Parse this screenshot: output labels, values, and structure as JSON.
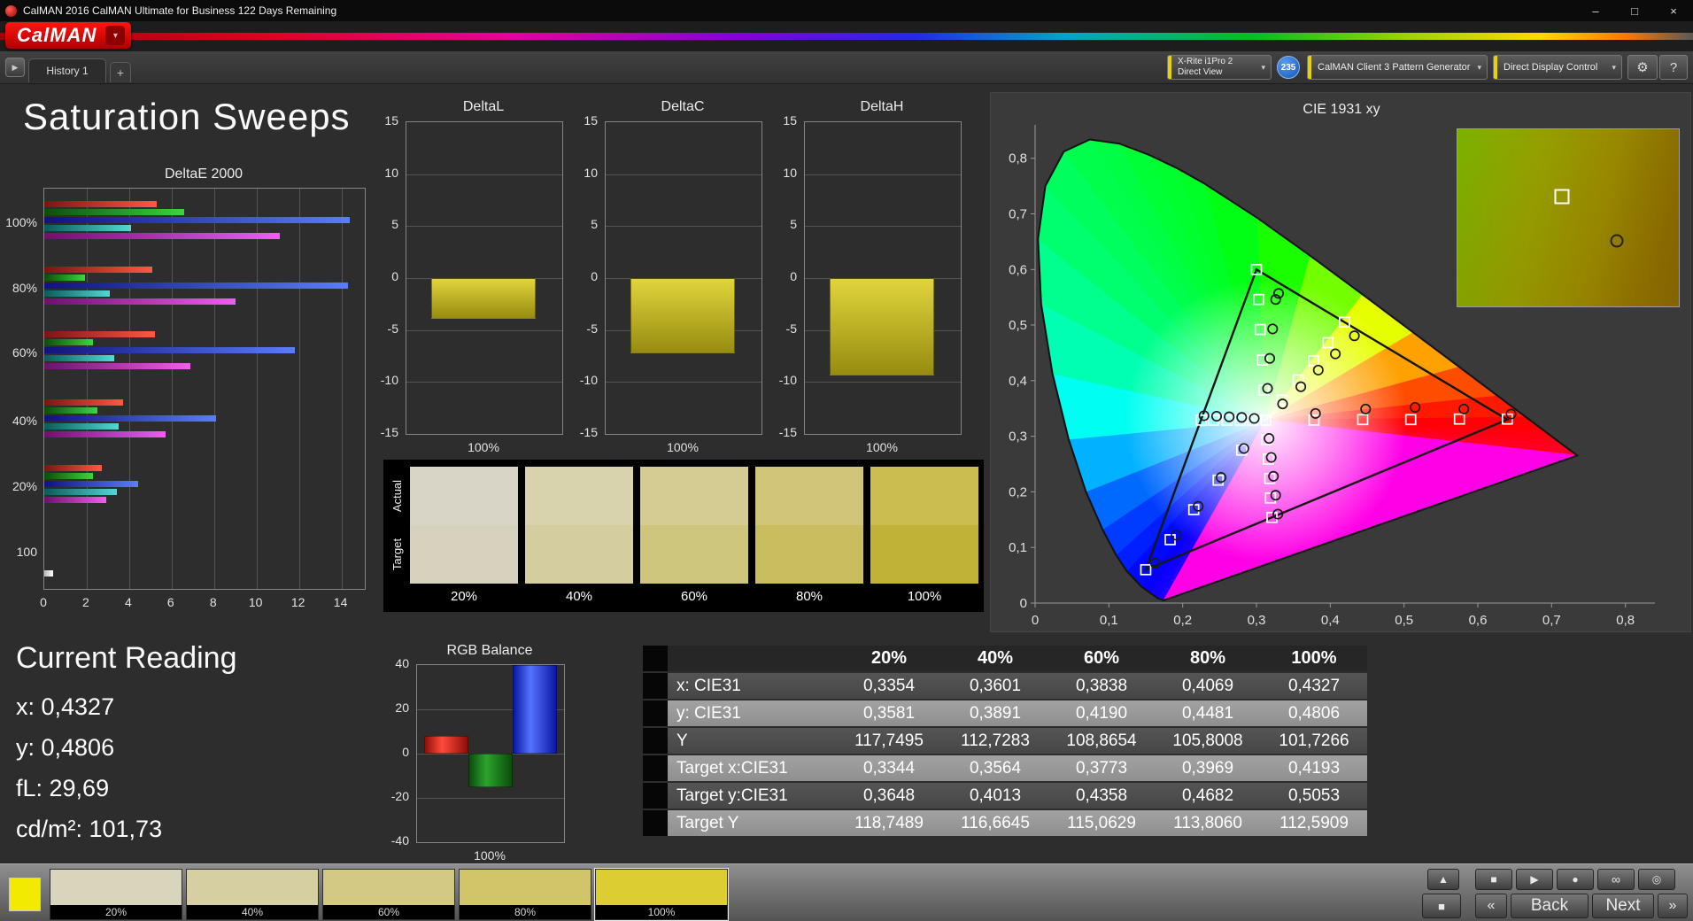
{
  "window": {
    "title": "CalMAN 2016 CalMAN Ultimate for Business 122 Days Remaining"
  },
  "icons": {
    "minimize": "–",
    "maximize": "□",
    "close": "×",
    "caret_down": "▾",
    "panel_toggle": "▶",
    "settings": "⚙",
    "help": "?",
    "eject": "▲",
    "panel_square": "■",
    "stop": "■",
    "play": "▶",
    "record": "●",
    "loop": "∞",
    "link": "◎",
    "prev_chevrons": "«",
    "next_chevrons": "»"
  },
  "brand": {
    "logo": "CalMAN"
  },
  "tabbar": {
    "history_tab": "History 1",
    "add_tab": "+"
  },
  "toolbar": {
    "meter_line1": "X-Rite i1Pro 2",
    "meter_line2": "Direct View",
    "meter_badge": "235",
    "pattern_generator": "CalMAN Client 3 Pattern Generator",
    "display_control": "Direct Display Control"
  },
  "page_title": "Saturation Sweeps",
  "chart_data": [
    {
      "type": "bar",
      "orientation": "horizontal",
      "title": "DeltaE 2000",
      "categories": [
        "100%",
        "80%",
        "60%",
        "40%",
        "20%",
        "100"
      ],
      "xlim": [
        0,
        15.1
      ],
      "xticks": [
        0,
        2,
        4,
        6,
        8,
        10,
        12,
        14
      ],
      "series": [
        {
          "name": "Red",
          "color1": "#7c1412",
          "color2": "#ff5844",
          "values": [
            5.3,
            5.1,
            5.2,
            3.7,
            2.7,
            0
          ]
        },
        {
          "name": "Green",
          "color1": "#0b4d0b",
          "color2": "#3fd43f",
          "values": [
            6.6,
            1.9,
            2.3,
            2.5,
            2.3,
            0
          ]
        },
        {
          "name": "Blue",
          "color1": "#10127e",
          "color2": "#5a7cff",
          "values": [
            14.4,
            14.3,
            11.8,
            8.1,
            4.4,
            0
          ]
        },
        {
          "name": "Cyan",
          "color1": "#0b5a5a",
          "color2": "#52d8d8",
          "values": [
            4.1,
            3.1,
            3.3,
            3.5,
            3.4,
            0
          ]
        },
        {
          "name": "Magenta",
          "color1": "#6c116c",
          "color2": "#ef5fef",
          "values": [
            11.1,
            9.0,
            6.9,
            5.7,
            2.9,
            0
          ]
        },
        {
          "name": "White",
          "color1": "#b8b8b8",
          "color2": "#ffffff",
          "values": [
            0,
            0,
            0,
            0,
            0,
            0.4
          ]
        }
      ]
    },
    {
      "type": "bar",
      "title": "DeltaL",
      "categories": [
        "100%"
      ],
      "values": [
        -3.9
      ],
      "ylim": [
        -15,
        15
      ],
      "yticks": [
        15,
        10,
        5,
        0,
        -5,
        -10,
        -15
      ],
      "bar_color1": "#e0d53c",
      "bar_color2": "#978c10"
    },
    {
      "type": "bar",
      "title": "DeltaC",
      "categories": [
        "100%"
      ],
      "values": [
        -7.2
      ],
      "ylim": [
        -15,
        15
      ],
      "yticks": [
        15,
        10,
        5,
        0,
        -5,
        -10,
        -15
      ],
      "bar_color1": "#e0d53c",
      "bar_color2": "#978c10"
    },
    {
      "type": "bar",
      "title": "DeltaH",
      "categories": [
        "100%"
      ],
      "values": [
        -9.4
      ],
      "ylim": [
        -15,
        15
      ],
      "yticks": [
        15,
        10,
        5,
        0,
        -5,
        -10,
        -15
      ],
      "bar_color1": "#e0d53c",
      "bar_color2": "#978c10"
    },
    {
      "type": "bar",
      "title": "RGB Balance",
      "categories": [
        "100%"
      ],
      "ylim": [
        -40,
        40
      ],
      "yticks": [
        40,
        20,
        0,
        -20,
        -40
      ],
      "series": [
        {
          "name": "Red",
          "value": 8,
          "color1": "#ff4a3c",
          "color2": "#8e0f08"
        },
        {
          "name": "Green",
          "value": -15,
          "color1": "#2da32d",
          "color2": "#0b4d0b"
        },
        {
          "name": "Blue",
          "value": 40,
          "color1": "#5572ff",
          "color2": "#0a17a6"
        }
      ]
    },
    {
      "type": "scatter",
      "title": "CIE 1931 xy",
      "xlim": [
        0,
        0.84
      ],
      "ylim": [
        0,
        0.86
      ],
      "xticks": [
        "0",
        "0,1",
        "0,2",
        "0,3",
        "0,4",
        "0,5",
        "0,6",
        "0,7",
        "0,8"
      ],
      "yticks": [
        "0",
        "0,1",
        "0,2",
        "0,3",
        "0,4",
        "0,5",
        "0,6",
        "0,7",
        "0,8"
      ],
      "gamut_triangle": [
        [
          0.64,
          0.33
        ],
        [
          0.3,
          0.6
        ],
        [
          0.15,
          0.06
        ]
      ],
      "white_point": [
        0.3127,
        0.329
      ],
      "target_squares": [
        [
          0.378,
          0.329
        ],
        [
          0.444,
          0.33
        ],
        [
          0.509,
          0.33
        ],
        [
          0.575,
          0.331
        ],
        [
          0.64,
          0.331
        ],
        [
          0.31,
          0.383
        ],
        [
          0.308,
          0.437
        ],
        [
          0.305,
          0.492
        ],
        [
          0.303,
          0.546
        ],
        [
          0.3,
          0.6
        ],
        [
          0.28,
          0.275
        ],
        [
          0.248,
          0.221
        ],
        [
          0.215,
          0.168
        ],
        [
          0.183,
          0.114
        ],
        [
          0.15,
          0.06
        ],
        [
          0.314,
          0.294
        ],
        [
          0.316,
          0.259
        ],
        [
          0.318,
          0.224
        ],
        [
          0.319,
          0.189
        ],
        [
          0.321,
          0.154
        ],
        [
          0.295,
          0.329
        ],
        [
          0.278,
          0.329
        ],
        [
          0.26,
          0.329
        ],
        [
          0.242,
          0.329
        ],
        [
          0.225,
          0.329
        ],
        [
          0.3344,
          0.3648
        ],
        [
          0.3564,
          0.4013
        ],
        [
          0.3773,
          0.4358
        ],
        [
          0.3969,
          0.4682
        ],
        [
          0.4193,
          0.5053
        ]
      ],
      "measured_circles": [
        [
          0.3354,
          0.3581
        ],
        [
          0.3601,
          0.3891
        ],
        [
          0.3838,
          0.419
        ],
        [
          0.4069,
          0.4481
        ],
        [
          0.4327,
          0.4806
        ],
        [
          0.38,
          0.341
        ],
        [
          0.448,
          0.349
        ],
        [
          0.515,
          0.352
        ],
        [
          0.581,
          0.349
        ],
        [
          0.645,
          0.34
        ],
        [
          0.315,
          0.386
        ],
        [
          0.318,
          0.44
        ],
        [
          0.322,
          0.493
        ],
        [
          0.326,
          0.546
        ],
        [
          0.33,
          0.557
        ],
        [
          0.283,
          0.278
        ],
        [
          0.252,
          0.226
        ],
        [
          0.221,
          0.174
        ],
        [
          0.191,
          0.122
        ],
        [
          0.163,
          0.072
        ],
        [
          0.317,
          0.296
        ],
        [
          0.32,
          0.262
        ],
        [
          0.323,
          0.228
        ],
        [
          0.326,
          0.194
        ],
        [
          0.329,
          0.16
        ],
        [
          0.297,
          0.332
        ],
        [
          0.28,
          0.334
        ],
        [
          0.263,
          0.335
        ],
        [
          0.246,
          0.336
        ],
        [
          0.229,
          0.337
        ]
      ],
      "inset": {
        "marker_square": [
          0.47,
          0.38
        ],
        "marker_circle": [
          0.72,
          0.63
        ]
      }
    }
  ],
  "swatch_panel": {
    "rows": [
      "Actual",
      "Target"
    ],
    "columns": [
      {
        "label": "20%",
        "actual": "#d9d5c6",
        "target": "#d7d2bd"
      },
      {
        "label": "40%",
        "actual": "#d8d2ad",
        "target": "#d4cda0"
      },
      {
        "label": "60%",
        "actual": "#d4cc92",
        "target": "#cfc67e"
      },
      {
        "label": "80%",
        "actual": "#d1c677",
        "target": "#c9bd5e"
      },
      {
        "label": "100%",
        "actual": "#cbbd50",
        "target": "#c0b236"
      }
    ]
  },
  "current_reading": {
    "title": "Current Reading",
    "lines": [
      "x: 0,4327",
      "y: 0,4806",
      "fL: 29,69",
      "cd/m²: 101,73"
    ]
  },
  "table": {
    "header": [
      "",
      "20%",
      "40%",
      "60%",
      "80%",
      "100%"
    ],
    "rows": [
      {
        "label": "x: CIE31",
        "values": [
          "0,3354",
          "0,3601",
          "0,3838",
          "0,4069",
          "0,4327"
        ]
      },
      {
        "label": "y: CIE31",
        "values": [
          "0,3581",
          "0,3891",
          "0,4190",
          "0,4481",
          "0,4806"
        ]
      },
      {
        "label": "Y",
        "values": [
          "117,7495",
          "112,7283",
          "108,8654",
          "105,8008",
          "101,7266"
        ]
      },
      {
        "label": "Target x:CIE31",
        "values": [
          "0,3344",
          "0,3564",
          "0,3773",
          "0,3969",
          "0,4193"
        ]
      },
      {
        "label": "Target y:CIE31",
        "values": [
          "0,3648",
          "0,4013",
          "0,4358",
          "0,4682",
          "0,5053"
        ]
      },
      {
        "label": "Target Y",
        "values": [
          "118,7489",
          "116,6645",
          "115,0629",
          "113,8060",
          "112,5909"
        ]
      }
    ]
  },
  "bottom": {
    "current_color": "#f2ea00",
    "swatches": [
      {
        "label": "20%",
        "color": "#d9d4bc"
      },
      {
        "label": "40%",
        "color": "#d6cfa2"
      },
      {
        "label": "60%",
        "color": "#d3c985"
      },
      {
        "label": "80%",
        "color": "#d0c569"
      },
      {
        "label": "100%",
        "color": "#dccd33",
        "selected": true
      }
    ],
    "back_label": "Back",
    "next_label": "Next"
  }
}
